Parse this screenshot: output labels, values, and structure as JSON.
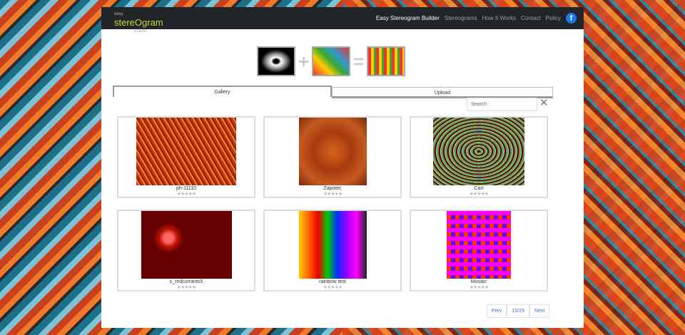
{
  "nav": {
    "logo_top": "easy",
    "logo_main": "stereOgram",
    "logo_bottom": "builder",
    "links": [
      "Easy Stereogram Builder",
      "Stereograms",
      "How It Works",
      "Contact",
      "Policy"
    ],
    "facebook": "f"
  },
  "formula": {
    "plus": "+",
    "equals": "="
  },
  "tabs": [
    "Gallery",
    "Upload"
  ],
  "search": {
    "placeholder": "Search",
    "clear": "✕"
  },
  "gallery": [
    {
      "name": "ph-11110",
      "rating": "★★★★★"
    },
    {
      "name": "Zapotec",
      "rating": "★★★★★"
    },
    {
      "name": "Cart",
      "rating": "★★★★★"
    },
    {
      "name": "s_redcurrants5",
      "rating": "★★★★★"
    },
    {
      "name": "rainbow test",
      "rating": "★★★★★"
    },
    {
      "name": "Mosaic",
      "rating": "★★★★★"
    }
  ],
  "pager": {
    "prev": "Prev",
    "page": "15/29",
    "next": "Next"
  }
}
